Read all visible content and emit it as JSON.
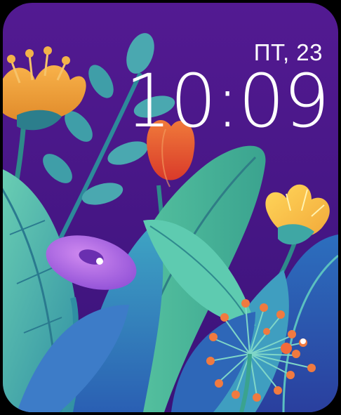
{
  "complication": {
    "date": "ПТ, 23",
    "time": "10:09"
  },
  "face": {
    "style": "flowers",
    "background_color": "#4a1a8c",
    "text_color": "#ffffff"
  }
}
